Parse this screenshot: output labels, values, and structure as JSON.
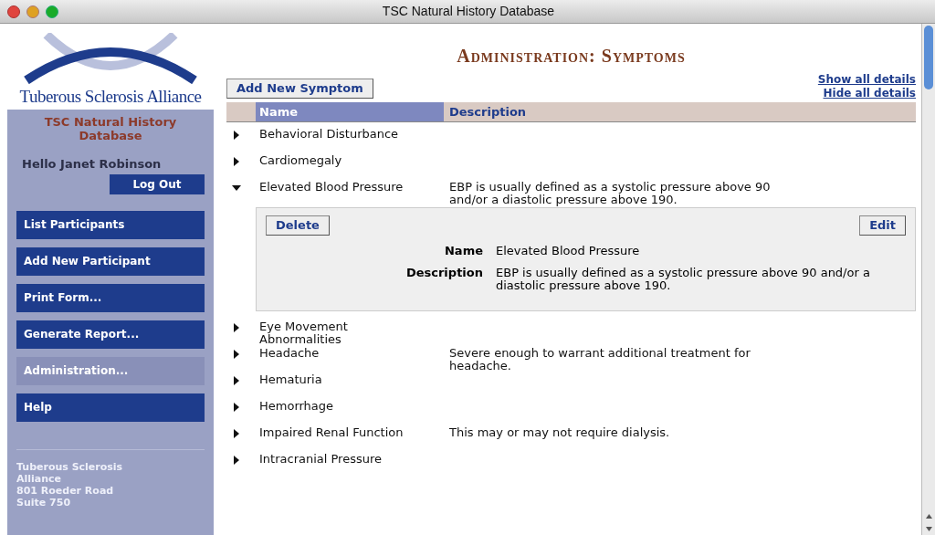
{
  "window": {
    "title": "TSC Natural History Database"
  },
  "sidebar": {
    "logo_text": "Tuberous Sclerosis Alliance",
    "app_title": "TSC Natural History Database",
    "greeting": "Hello Janet Robinson",
    "logout": "Log Out",
    "items": [
      {
        "label": "List Participants",
        "selected": false
      },
      {
        "label": "Add New Participant",
        "selected": false
      },
      {
        "label": "Print Form...",
        "selected": false
      },
      {
        "label": "Generate Report...",
        "selected": false
      },
      {
        "label": "Administration...",
        "selected": true
      },
      {
        "label": "Help",
        "selected": false
      }
    ],
    "address": [
      "Tuberous Sclerosis",
      "Alliance",
      "801 Roeder Road",
      "Suite 750"
    ]
  },
  "page": {
    "title": "Administration: Symptoms",
    "add_button": "Add New Symptom",
    "links": [
      "Show all details",
      "Hide all details"
    ]
  },
  "table": {
    "columns": [
      "Name",
      "Description"
    ],
    "rows": [
      {
        "name": "Behavioral Disturbance",
        "expanded": false
      },
      {
        "name": "Cardiomegaly",
        "expanded": false
      },
      {
        "name": "Elevated Blood Pressure",
        "description": "EBP is usually defined as a systolic pressure above 90 and/or a diastolic pressure above 190.",
        "expanded": true,
        "detail": {
          "delete": "Delete",
          "edit": "Edit",
          "fields": [
            {
              "label": "Name",
              "value": "Elevated Blood Pressure"
            },
            {
              "label": "Description",
              "value": "EBP is usually defined as a systolic pressure above 90 and/or a diastolic pressure above 190."
            }
          ]
        }
      },
      {
        "name": "Eye Movement Abnormalities",
        "expanded": false
      },
      {
        "name": "Headache",
        "description": "Severe enough to warrant additional treatment for headache.",
        "expanded": false
      },
      {
        "name": "Hematuria",
        "expanded": false
      },
      {
        "name": "Hemorrhage",
        "expanded": false
      },
      {
        "name": "Impaired Renal Function",
        "description": "This may or may not require dialysis.",
        "expanded": false
      },
      {
        "name": "Intracranial Pressure",
        "expanded": false
      }
    ]
  }
}
